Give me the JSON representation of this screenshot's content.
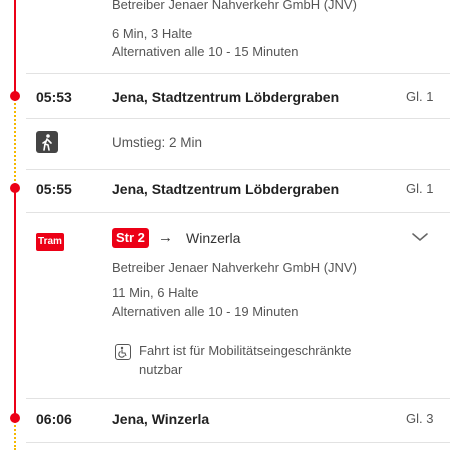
{
  "top_segment": {
    "operator": "Betreiber Jenaer Nahverkehr GmbH (JNV)",
    "duration": "6 Min, 3 Halte",
    "alternatives": "Alternativen alle 10 - 15 Minuten"
  },
  "stop1": {
    "time": "05:53",
    "name": "Jena, Stadtzentrum Löbdergraben",
    "platform": "Gl. 1"
  },
  "transfer": {
    "label": "Umstieg: 2 Min",
    "icon": "walking-person-icon"
  },
  "stop2": {
    "time": "05:55",
    "name": "Jena, Stadtzentrum Löbdergraben",
    "platform": "Gl. 1"
  },
  "tram_segment": {
    "logo": "Tram",
    "line": "Str 2",
    "arrow": "→",
    "destination": "Winzerla",
    "operator": "Betreiber Jenaer Nahverkehr GmbH (JNV)",
    "duration": "11 Min, 6 Halte",
    "alternatives": "Alternativen alle 10 - 19 Minuten",
    "accessibility_line1": "Fahrt ist für Mobilitätseingeschränkte",
    "accessibility_line2": "nutzbar"
  },
  "stop3": {
    "time": "06:06",
    "name": "Jena, Winzerla",
    "platform": "Gl. 3"
  },
  "colors": {
    "accent": "#ec0016",
    "walk": "#f5b800"
  }
}
